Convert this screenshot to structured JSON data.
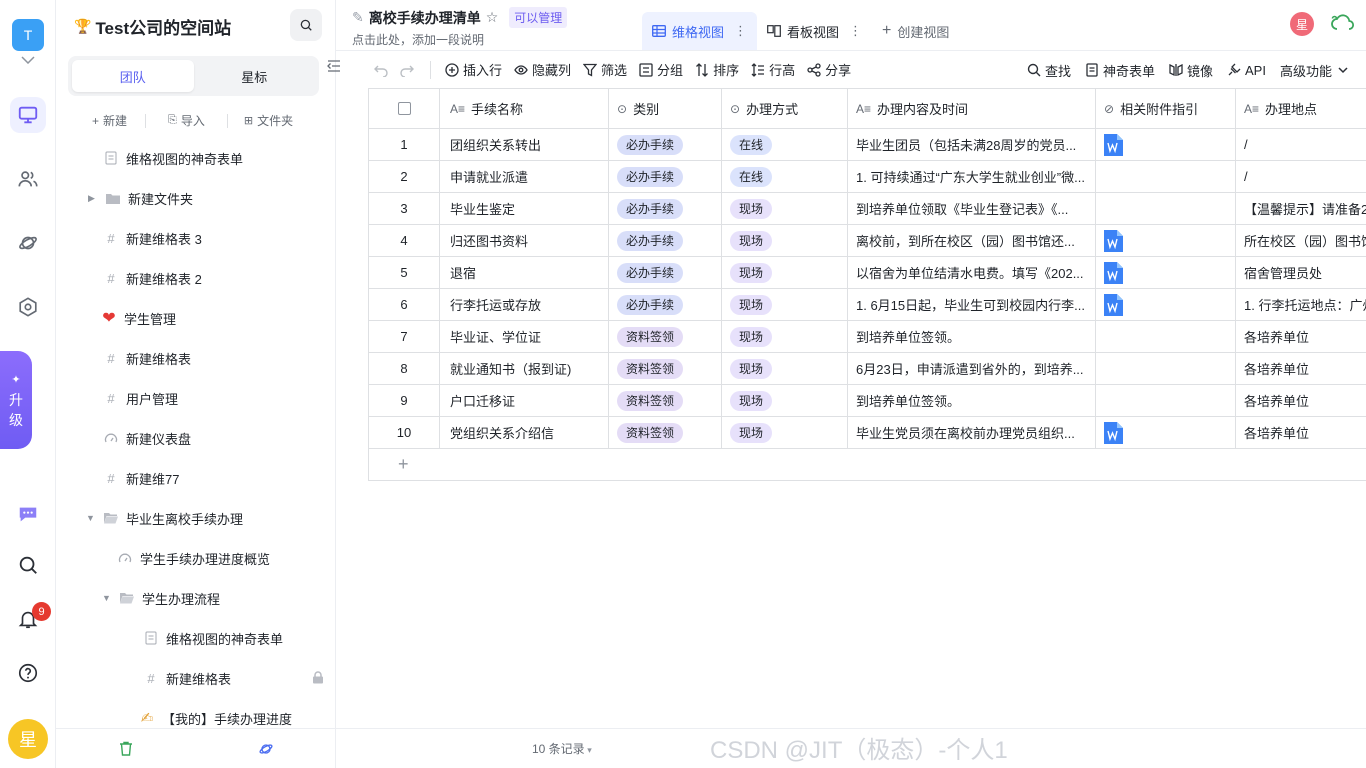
{
  "rail": {
    "workspace_letter": "T",
    "upgrade_chars": [
      "升",
      "级"
    ],
    "notification_count": "9",
    "user_avatar": "星",
    "icons": [
      "monitor-icon",
      "users-icon",
      "planet-icon",
      "hexagon-settings-icon",
      "chat-icon",
      "search-icon",
      "bell-icon",
      "help-icon"
    ]
  },
  "sidebar": {
    "space_title": "Test公司的空间站",
    "tabs": [
      "团队",
      "星标"
    ],
    "active_tab": "团队",
    "actions": {
      "new": "新建",
      "import": "导入",
      "folder": "文件夹"
    },
    "items": [
      {
        "label": "维格视图的神奇表单",
        "icon": "form-icon",
        "level": 0
      },
      {
        "label": "新建文件夹",
        "icon": "folder-icon",
        "level": 0,
        "caret": "collapsed"
      },
      {
        "label": "新建维格表 3",
        "icon": "grid-hash-icon",
        "level": 0
      },
      {
        "label": "新建维格表 2",
        "icon": "grid-hash-icon",
        "level": 0
      },
      {
        "label": "学生管理",
        "icon": "heart-icon",
        "level": 0
      },
      {
        "label": "新建维格表",
        "icon": "grid-hash-icon",
        "level": 0
      },
      {
        "label": "用户管理",
        "icon": "grid-hash-icon",
        "level": 0
      },
      {
        "label": "新建仪表盘",
        "icon": "dashboard-icon",
        "level": 0
      },
      {
        "label": "新建维77",
        "icon": "grid-hash-icon",
        "level": 0
      },
      {
        "label": "毕业生离校手续办理",
        "icon": "folder-open-icon",
        "level": 0,
        "caret": "expanded"
      },
      {
        "label": "学生手续办理进度概览",
        "icon": "dashboard-icon",
        "level": 1
      },
      {
        "label": "学生办理流程",
        "icon": "folder-open-icon",
        "level": 1,
        "caret": "expanded"
      },
      {
        "label": "维格视图的神奇表单",
        "icon": "form-icon",
        "level": 2
      },
      {
        "label": "新建维格表",
        "icon": "grid-hash-icon",
        "level": 2,
        "locked": true
      },
      {
        "label": "【我的】手续办理进度",
        "icon": "writing-hand-icon",
        "level": 2
      }
    ],
    "bottom_icons": [
      "trash-icon",
      "planet-icon"
    ]
  },
  "header": {
    "title": "离校手续办理清单",
    "permission": "可以管理",
    "description": "点击此处，添加一段说明",
    "views": [
      {
        "label": "维格视图",
        "active": true
      },
      {
        "label": "看板视图",
        "active": false
      }
    ],
    "create_view": "创建视图",
    "user_avatar": "星"
  },
  "toolbar": {
    "left": [
      "插入行",
      "隐藏列",
      "筛选",
      "分组",
      "排序",
      "行高",
      "分享"
    ],
    "right": [
      "查找",
      "神奇表单",
      "镜像",
      "API",
      "高级功能"
    ]
  },
  "table": {
    "columns": [
      "手续名称",
      "类别",
      "办理方式",
      "办理内容及时间",
      "相关附件指引",
      "办理地点"
    ],
    "rows": [
      {
        "no": "1",
        "name": "团组织关系转出",
        "category": "必办手续",
        "method": "在线",
        "content": "毕业生团员（包括未满28周岁的党员...",
        "attachment": true,
        "place": "/"
      },
      {
        "no": "2",
        "name": "申请就业派遣",
        "category": "必办手续",
        "method": "在线",
        "content": "1. 可持续通过“广东大学生就业创业”微...",
        "attachment": false,
        "place": "/"
      },
      {
        "no": "3",
        "name": "毕业生鉴定",
        "category": "必办手续",
        "method": "现场",
        "content": "到培养单位领取《毕业生登记表》《...",
        "attachment": false,
        "place": "【温馨提示】请准备2"
      },
      {
        "no": "4",
        "name": "归还图书资料",
        "category": "必办手续",
        "method": "现场",
        "content": "离校前，到所在校区（园）图书馆还...",
        "attachment": true,
        "place": "所在校区（园）图书馆"
      },
      {
        "no": "5",
        "name": "退宿",
        "category": "必办手续",
        "method": "现场",
        "content": "以宿舍为单位结清水电费。填写《202...",
        "attachment": true,
        "place": "宿舍管理员处"
      },
      {
        "no": "6",
        "name": "行李托运或存放",
        "category": "必办手续",
        "method": "现场",
        "content": "1. 6月15日起，毕业生可到校园内行李...",
        "attachment": true,
        "place": "1. 行李托运地点：广州"
      },
      {
        "no": "7",
        "name": "毕业证、学位证",
        "category": "资料签领",
        "method": "现场",
        "content": "到培养单位签领。",
        "attachment": false,
        "place": "各培养单位"
      },
      {
        "no": "8",
        "name": "就业通知书（报到证)",
        "category": "资料签领",
        "method": "现场",
        "content": "6月23日，申请派遣到省外的，到培养...",
        "attachment": false,
        "place": "各培养单位"
      },
      {
        "no": "9",
        "name": "户口迁移证",
        "category": "资料签领",
        "method": "现场",
        "content": "到培养单位签领。",
        "attachment": false,
        "place": "各培养单位"
      },
      {
        "no": "10",
        "name": "党组织关系介绍信",
        "category": "资料签领",
        "method": "现场",
        "content": "毕业生党员须在离校前办理党员组织...",
        "attachment": true,
        "place": "各培养单位"
      }
    ]
  },
  "footer": {
    "record_count": "10 条记录"
  },
  "watermark": "CSDN @JIT（极态）-个人1"
}
